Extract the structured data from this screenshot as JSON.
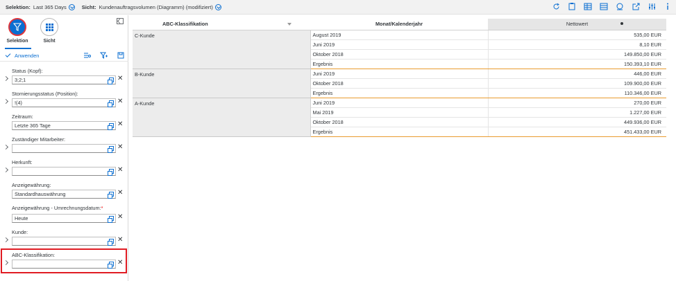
{
  "topbar": {
    "selection_label": "Selektion:",
    "selection_value": "Last 365 Days",
    "view_label": "Sicht:",
    "view_value": "Kundenauftragsvolumen (Diagramm) (modifiziert)",
    "icons": [
      "refresh-icon",
      "clipboard-icon",
      "table-icon",
      "table-settings-icon",
      "chart-icon",
      "export-icon",
      "settings-icon",
      "info-icon"
    ]
  },
  "panel": {
    "tabs": [
      {
        "label": "Selektion",
        "icon": "filter-icon",
        "active": true
      },
      {
        "label": "Sicht",
        "icon": "grid-icon",
        "active": false
      }
    ],
    "apply_label": "Anwenden",
    "fields": [
      {
        "label": "Status (Kopf):",
        "value": "3;2;1",
        "expandable": true
      },
      {
        "label": "Stornierungsstatus (Position):",
        "value": "!(4)",
        "expandable": true
      },
      {
        "label": "Zeitraum:",
        "value": "Letzte 365 Tage",
        "expandable": false
      },
      {
        "label": "Zuständiger Mitarbeiter:",
        "value": "",
        "expandable": true
      },
      {
        "label": "Herkunft:",
        "value": "",
        "expandable": true
      },
      {
        "label": "Anzeigewährung:",
        "value": "Standardhauswährung",
        "expandable": false
      },
      {
        "label": "Anzeigewährung - Umrechnungsdatum:",
        "value": "Heute",
        "expandable": false,
        "required": true
      },
      {
        "label": "Kunde:",
        "value": "",
        "expandable": true
      },
      {
        "label": "ABC-Klassifikation:",
        "value": "",
        "expandable": true
      }
    ]
  },
  "table": {
    "headers": [
      "ABC-Klassifikation",
      "Monat/Kalenderjahr",
      "Nettowert"
    ],
    "groups": [
      {
        "name": "C-Kunde",
        "rows": [
          {
            "month": "August 2019",
            "amount": "535,00 EUR"
          },
          {
            "month": "Juni 2019",
            "amount": "8,10 EUR"
          },
          {
            "month": "Oktober 2018",
            "amount": "149.850,00 EUR"
          },
          {
            "month": "Ergebnis",
            "amount": "150.393,10 EUR",
            "total": true
          }
        ]
      },
      {
        "name": "B-Kunde",
        "rows": [
          {
            "month": "Juni 2019",
            "amount": "446,00 EUR"
          },
          {
            "month": "Oktober 2018",
            "amount": "109.900,00 EUR"
          },
          {
            "month": "Ergebnis",
            "amount": "110.346,00 EUR",
            "total": true
          }
        ]
      },
      {
        "name": "A-Kunde",
        "rows": [
          {
            "month": "Juni 2019",
            "amount": "270,00 EUR"
          },
          {
            "month": "Mai 2019",
            "amount": "1.227,00 EUR"
          },
          {
            "month": "Oktober 2018",
            "amount": "449.936,00 EUR"
          },
          {
            "month": "Ergebnis",
            "amount": "451.433,00 EUR",
            "total": true
          }
        ]
      }
    ]
  },
  "colors": {
    "accent": "#0a6ed1",
    "highlight": "#e01b22",
    "total_line": "#e99b2e"
  }
}
